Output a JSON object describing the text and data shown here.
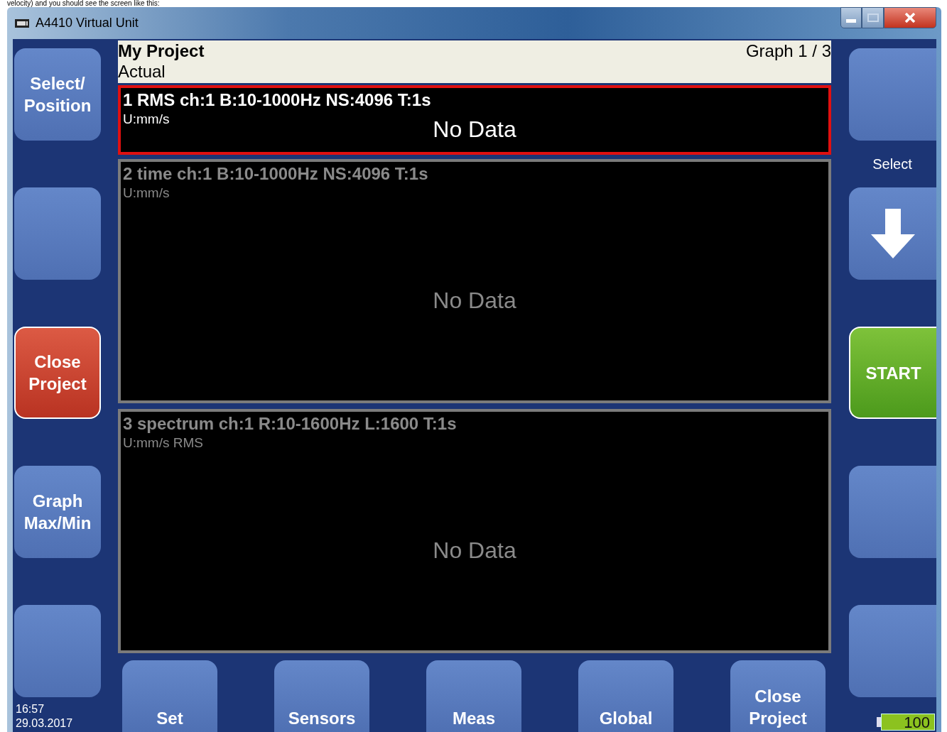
{
  "caption": "velocity) and you should see the screen like this:",
  "window": {
    "title": "A4410 Virtual Unit"
  },
  "left_buttons": [
    {
      "kind": "normal",
      "lines": [
        "Select/",
        "Position"
      ]
    },
    {
      "kind": "normal"
    },
    {
      "kind": "danger",
      "lines": [
        "Close",
        "Project"
      ]
    },
    {
      "kind": "normal",
      "lines": [
        "Graph",
        "Max/Min"
      ]
    },
    {
      "kind": "normal"
    }
  ],
  "right_buttons": [
    {
      "kind": "normal"
    },
    {
      "kind": "arrow",
      "label_above": "Select"
    },
    {
      "kind": "start",
      "lines": [
        "START"
      ]
    },
    {
      "kind": "normal"
    },
    {
      "kind": "normal"
    }
  ],
  "header": {
    "project": "My Project",
    "mode": "Actual",
    "graph_counter": "Graph 1 / 3"
  },
  "graphs": [
    {
      "title": "1 RMS ch:1 B:10-1000Hz NS:4096 T:1s",
      "unit": "U:mm/s",
      "message": "No Data",
      "selected": true
    },
    {
      "title": "2 time ch:1 B:10-1000Hz NS:4096 T:1s",
      "unit": "U:mm/s",
      "message": "No Data",
      "selected": false
    },
    {
      "title": "3 spectrum ch:1 R:10-1600Hz L:1600 T:1s",
      "unit": "U:mm/s RMS",
      "message": "No Data",
      "selected": false
    }
  ],
  "bottom_buttons": [
    {
      "lines": [
        "Set"
      ]
    },
    {
      "lines": [
        "Sensors"
      ]
    },
    {
      "lines": [
        "Meas"
      ]
    },
    {
      "lines": [
        "Global"
      ]
    },
    {
      "lines": [
        "Close",
        "Project"
      ]
    }
  ],
  "status": {
    "time": "16:57",
    "date": "29.03.2017",
    "battery": "100"
  }
}
